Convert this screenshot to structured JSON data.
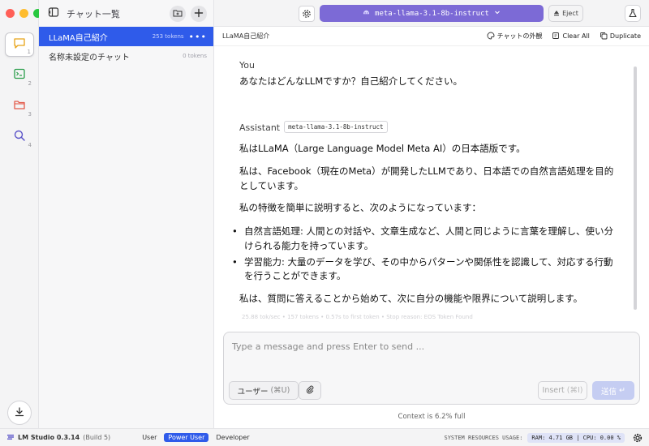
{
  "sidebar": {
    "items": [
      {
        "icon": "chat-icon",
        "num": "1"
      },
      {
        "icon": "terminal-icon",
        "num": "2"
      },
      {
        "icon": "folder-icon",
        "num": "3"
      },
      {
        "icon": "search-icon",
        "num": "4"
      }
    ]
  },
  "chat_list": {
    "title": "チャット一覧",
    "chats": [
      {
        "name": "LLaMA自己紹介",
        "tokens": "253 tokens"
      },
      {
        "name": "名称未設定のチャット",
        "tokens": "0 tokens"
      }
    ]
  },
  "topbar": {
    "model": "meta-llama-3.1-8b-instruct",
    "eject": "Eject"
  },
  "subheader": {
    "title": "LLaMA自己紹介",
    "appearance": "チャットの外観",
    "clear_all": "Clear All",
    "duplicate": "Duplicate"
  },
  "messages": {
    "user_role": "You",
    "user_text": "あなたはどんなLLMですか？自己紹介してください。",
    "assistant_role": "Assistant",
    "assistant_model": "meta-llama-3.1-8b-instruct",
    "p1": "私はLLaMA（Large Language Model Meta AI）の日本語版です。",
    "p2": "私は、Facebook（現在のMeta）が開発したLLMであり、日本語での自然言語処理を目的としています。",
    "p3": "私の特徴を簡単に説明すると、次のようになっています：",
    "bullets": [
      "自然言語処理: 人間との対話や、文章生成など、人間と同じように言葉を理解し、使い分けられる能力を持っています。",
      "学習能力: 大量のデータを学び、その中からパターンや関係性を認識して、対応する行動を行うことができます。"
    ],
    "p4": "私は、質問に答えることから始めて、次に自分の機能や限界について説明します。",
    "stats": "25.88 tok/sec  •  157 tokens  •  0.57s to first token  •  Stop reason: EOS Token Found"
  },
  "input": {
    "placeholder": "Type a message and press Enter to send ...",
    "role_button": "ユーザー",
    "role_shortcut": "(⌘U)",
    "insert": "Insert",
    "insert_shortcut": "(⌘I)",
    "send": "送信",
    "send_icon": "↵",
    "context": "Context is 6.2% full"
  },
  "statusbar": {
    "app": "LM Studio 0.3.14",
    "build": "(Build 5)",
    "modes": [
      "User",
      "Power User",
      "Developer"
    ],
    "selected_mode": "Power User",
    "resources_label": "SYSTEM RESOURCES USAGE:",
    "resources": "RAM: 4.71 GB  |  CPU: 0.00 %"
  },
  "colors": {
    "accent": "#2f5bea",
    "model_bg": "#7c6ad6",
    "chat_icon": "#e8a317",
    "terminal_icon": "#2a9d4a",
    "folder_icon": "#e35a4a",
    "search_icon": "#5b54c9"
  }
}
